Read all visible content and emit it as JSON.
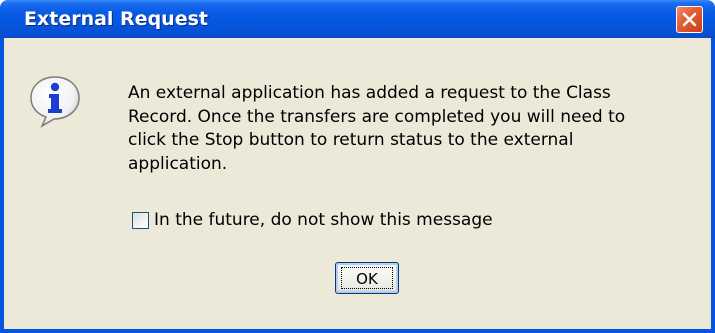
{
  "dialog": {
    "title": "External Request",
    "close_icon": "close-icon",
    "info_icon": "info-icon",
    "message": "An external application has added a request to the Class\nRecord.  Once the transfers are completed you will need to\nclick the Stop button to return status to the external\napplication.",
    "checkbox": {
      "label": "In the future, do not show this message",
      "checked": false
    },
    "ok_label": "OK"
  },
  "colors": {
    "titlebar": "#0554e2",
    "client": "#ece9d8",
    "close_button": "#e35b34"
  }
}
